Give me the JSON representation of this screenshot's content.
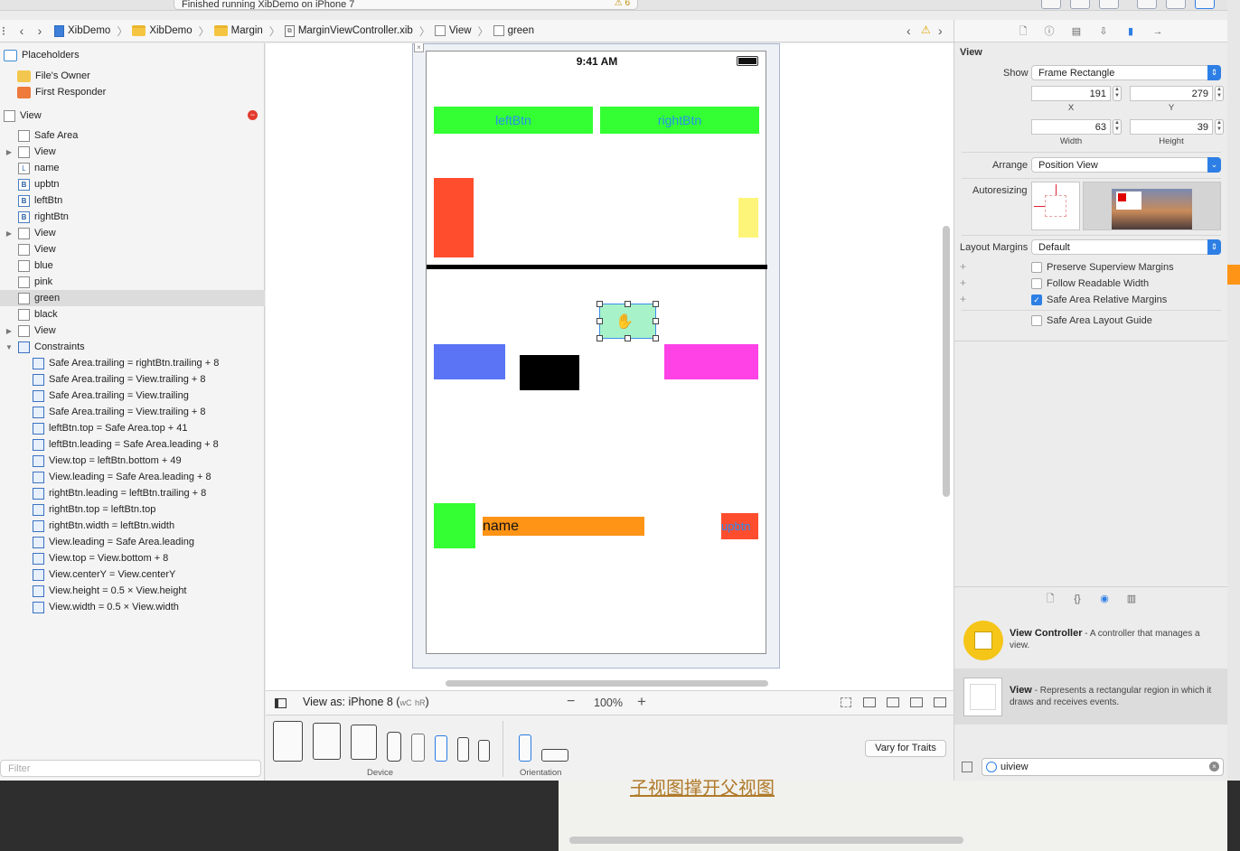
{
  "toolbar": {
    "status": "Finished running XibDemo on iPhone 7",
    "warning_count": "6"
  },
  "jumpbar": {
    "crumbs": [
      "XibDemo",
      "XibDemo",
      "Margin",
      "MarginViewController.xib",
      "View",
      "green"
    ]
  },
  "outline": {
    "placeholders_title": "Placeholders",
    "files_owner": "File's Owner",
    "first_responder": "First Responder",
    "view_title": "View",
    "items": [
      "Safe Area",
      "View",
      "name",
      "upbtn",
      "leftBtn",
      "rightBtn",
      "View",
      "View",
      "blue",
      "pink",
      "green",
      "black",
      "View"
    ],
    "item_badges": [
      "",
      "",
      "L",
      "B",
      "B",
      "B",
      "",
      "",
      "",
      "",
      "",
      "",
      ""
    ],
    "constraints_title": "Constraints",
    "constraints": [
      "Safe Area.trailing = rightBtn.trailing + 8",
      "Safe Area.trailing = View.trailing + 8",
      "Safe Area.trailing = View.trailing",
      "Safe Area.trailing = View.trailing + 8",
      "leftBtn.top = Safe Area.top + 41",
      "leftBtn.leading = Safe Area.leading + 8",
      "View.top = leftBtn.bottom + 49",
      "View.leading = Safe Area.leading + 8",
      "rightBtn.leading = leftBtn.trailing + 8",
      "rightBtn.top = leftBtn.top",
      "rightBtn.width = leftBtn.width",
      "View.leading = Safe Area.leading",
      "View.top = View.bottom + 8",
      "View.centerY = View.centerY",
      "View.height = 0.5 × View.height",
      "View.width = 0.5 × View.width"
    ],
    "filter_placeholder": "Filter"
  },
  "canvas": {
    "clock": "9:41 AM",
    "left_btn": "leftBtn",
    "right_btn": "rightBtn",
    "name_label": "name",
    "up_btn": "upbtn",
    "colors": {
      "green": "#33ff33",
      "red": "#ff4d2e",
      "yellow": "#fdf579",
      "blue": "#5a74f5",
      "black": "#000000",
      "mint": "#a7f2c9",
      "pink": "#ff42e6",
      "orange": "#ff9416",
      "button_text": "#2a8cf0"
    }
  },
  "bottombar": {
    "view_as": "View as: iPhone 8 (",
    "traits_w": "wC",
    "traits_h": "hR",
    "traits_close": ")",
    "zoom": "100%",
    "device_label": "Device",
    "orientation_label": "Orientation",
    "vary_button": "Vary for Traits"
  },
  "inspector": {
    "section_title": "View",
    "show_label": "Show",
    "show_value": "Frame Rectangle",
    "x": "191",
    "y": "279",
    "x_label": "X",
    "y_label": "Y",
    "width": "63",
    "height": "39",
    "width_label": "Width",
    "height_label": "Height",
    "arrange_label": "Arrange",
    "arrange_value": "Position View",
    "autoresizing_label": "Autoresizing",
    "layout_margins_label": "Layout Margins",
    "layout_margins_value": "Default",
    "preserve": "Preserve Superview Margins",
    "readable": "Follow Readable Width",
    "safe_area_margins": "Safe Area Relative Margins",
    "safe_area_guide": "Safe Area Layout Guide",
    "checks": {
      "preserve": false,
      "readable": false,
      "safe_area_margins": true,
      "safe_area_guide": false
    }
  },
  "library": {
    "items": [
      {
        "title": "View Controller",
        "desc": " - A controller that manages a view."
      },
      {
        "title": "View",
        "desc": " - Represents a rectangular region in which it draws and receives events."
      }
    ],
    "search_value": "uiview"
  },
  "background": {
    "chinese_text": "子视图撑开父视图"
  }
}
